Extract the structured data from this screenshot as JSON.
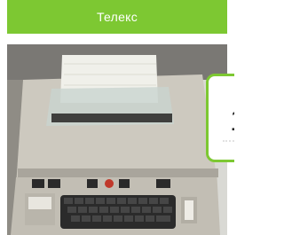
{
  "card": {
    "title": "Телекс",
    "accent_color": "#7dc832",
    "image_subject": "teletype-machine-photo"
  },
  "callout": {
    "number": "1"
  }
}
